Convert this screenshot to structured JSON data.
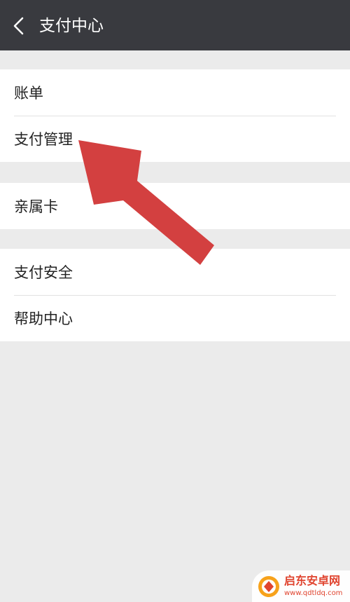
{
  "header": {
    "title": "支付中心",
    "back_icon": "chevron-left-icon",
    "background": "#393a3f"
  },
  "groups": [
    {
      "items": [
        {
          "label": "账单"
        },
        {
          "label": "支付管理"
        }
      ]
    },
    {
      "items": [
        {
          "label": "亲属卡"
        }
      ]
    },
    {
      "items": [
        {
          "label": "支付安全"
        },
        {
          "label": "帮助中心"
        }
      ]
    }
  ],
  "annotation": {
    "icon": "red-pointer-arrow",
    "color": "#d34040",
    "target": "支付管理"
  },
  "watermark": {
    "title": "启东安卓网",
    "url": "www.qdtldq.com",
    "color": "#e0442f"
  }
}
